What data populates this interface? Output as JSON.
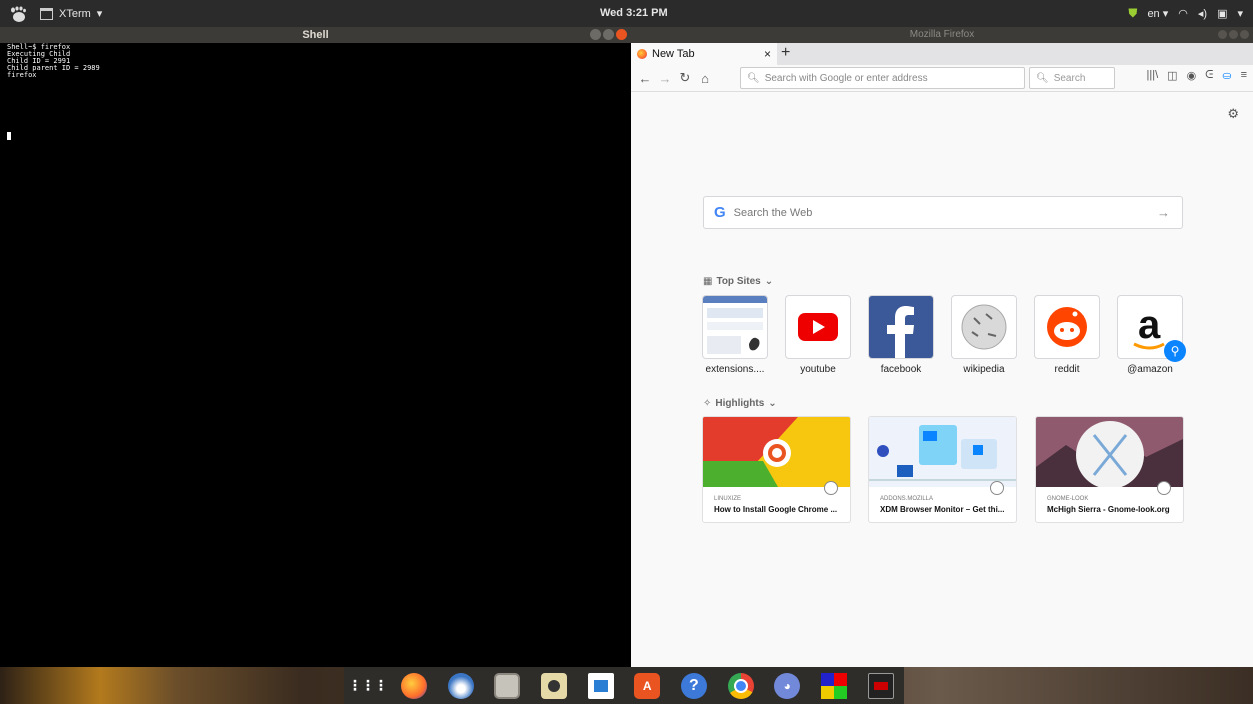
{
  "topbar": {
    "app_name": "XTerm",
    "clock": "Wed  3:21 PM",
    "keyboard_layout": "en"
  },
  "xterm": {
    "title": "Shell",
    "lines": [
      "Shell~$ firefox",
      "Executing Child",
      "Child ID = 2991",
      "Child parent ID = 2989",
      "firefox"
    ]
  },
  "firefox": {
    "window_title": "Mozilla Firefox",
    "tab_title": "New Tab",
    "url_placeholder": "Search with Google or enter address",
    "search_placeholder": "Search",
    "web_search_placeholder": "Search the Web",
    "top_sites_title": "Top Sites",
    "highlights_title": "Highlights",
    "top_sites": [
      {
        "label": "extensions...."
      },
      {
        "label": "youtube"
      },
      {
        "label": "facebook"
      },
      {
        "label": "wikipedia"
      },
      {
        "label": "reddit"
      },
      {
        "label": "@amazon"
      }
    ],
    "highlights": [
      {
        "source": "LINUXIZE",
        "title": "How to Install Google Chrome ..."
      },
      {
        "source": "ADDONS.MOZILLA",
        "title": "XDM Browser Monitor – Get thi..."
      },
      {
        "source": "GNOME-LOOK",
        "title": "McHigh Sierra - Gnome-look.org"
      }
    ]
  },
  "dock": {
    "items": [
      "show-apps-icon",
      "firefox-icon",
      "thunderbird-icon",
      "files-icon",
      "rhythmbox-icon",
      "libreoffice-writer-icon",
      "ubuntu-software-icon",
      "help-icon",
      "chrome-icon",
      "discord-icon",
      "colors-app-icon",
      "xterm-icon"
    ]
  }
}
